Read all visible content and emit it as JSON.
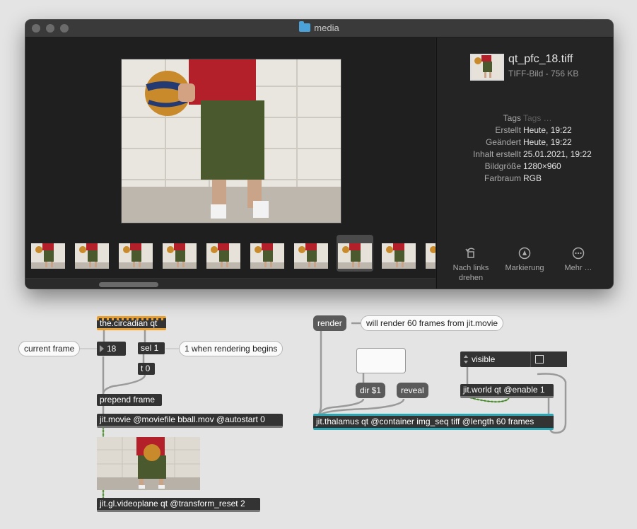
{
  "finder": {
    "title": "media",
    "file_name": "qt_pfc_18.tiff",
    "file_sub": "TIFF-Bild - 756 KB",
    "metadata": [
      {
        "key": "Tags",
        "value": "Tags …",
        "dim": true
      },
      {
        "key": "Erstellt",
        "value": "Heute, 19:22"
      },
      {
        "key": "Geändert",
        "value": "Heute, 19:22"
      },
      {
        "key": "Inhalt erstellt",
        "value": "25.01.2021, 19:22"
      },
      {
        "key": "Bildgröße",
        "value": "1280×960"
      },
      {
        "key": "Farbraum",
        "value": "RGB"
      }
    ],
    "actions": [
      {
        "label1": "Nach links",
        "label2": "drehen",
        "icon": "rotate-left-icon"
      },
      {
        "label1": "Markierung",
        "label2": "",
        "icon": "markup-icon"
      },
      {
        "label1": "Mehr …",
        "label2": "",
        "icon": "more-icon"
      }
    ],
    "thumbnail_count": 10,
    "selected_thumbnail": 7
  },
  "patch": {
    "circadian": "the.circadian qt",
    "sel": "sel 1",
    "t0": "t 0",
    "number": "18",
    "prepend": "prepend frame",
    "movie": "jit.movie @moviefile bball.mov @autostart 0",
    "videoplane": "jit.gl.videoplane qt @transform_reset 2",
    "comment_current_frame": "current frame",
    "comment_rendering": "1 when rendering begins",
    "render": "render",
    "comment_render": "will render 60 frames from jit.movie",
    "dir": "dir $1",
    "reveal": "reveal",
    "umenu_value": "visible",
    "world": "jit.world qt @enable 1",
    "thalamus": "jit.thalamus qt @container img_seq tiff @length 60 frames"
  },
  "colors": {
    "accent_orange": "#e8a033",
    "accent_teal": "#2aa6b4",
    "object_bg": "#333333",
    "patch_bg": "#e4e4e4"
  }
}
